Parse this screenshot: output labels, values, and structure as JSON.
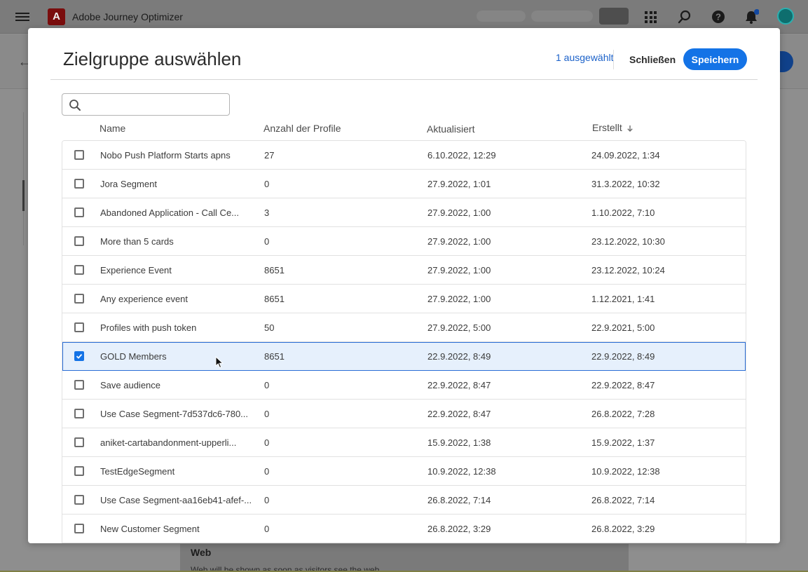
{
  "app": {
    "title": "Adobe Journey Optimizer",
    "logo_letter": "A"
  },
  "modal": {
    "title": "Zielgruppe auswählen",
    "selected_count": "1 ausgewählt",
    "close_label": "Schließen",
    "save_label": "Speichern",
    "search": {
      "value": "",
      "placeholder": ""
    }
  },
  "table": {
    "headers": {
      "name": "Name",
      "count": "Anzahl der Profile",
      "updated": "Aktualisiert",
      "created": "Erstellt"
    },
    "sort": {
      "column": "created",
      "direction": "descending"
    },
    "rows": [
      {
        "name": "Nobo Push Platform Starts apns",
        "count": "27",
        "updated": "6.10.2022, 12:29",
        "created": "24.09.2022, 1:34",
        "selected": false
      },
      {
        "name": "Jora Segment",
        "count": "0",
        "updated": "27.9.2022, 1:01",
        "created": "31.3.2022, 10:32",
        "selected": false
      },
      {
        "name": "Abandoned Application - Call Ce...",
        "count": "3",
        "updated": "27.9.2022, 1:00",
        "created": "1.10.2022, 7:10",
        "selected": false
      },
      {
        "name": "More than 5 cards",
        "count": "0",
        "updated": "27.9.2022, 1:00",
        "created": "23.12.2022, 10:30",
        "selected": false
      },
      {
        "name": "Experience Event",
        "count": "8651",
        "updated": "27.9.2022, 1:00",
        "created": "23.12.2022, 10:24",
        "selected": false
      },
      {
        "name": "Any experience event",
        "count": "8651",
        "updated": "27.9.2022, 1:00",
        "created": "1.12.2021, 1:41",
        "selected": false
      },
      {
        "name": "Profiles with push token",
        "count": "50",
        "updated": "27.9.2022, 5:00",
        "created": "22.9.2021, 5:00",
        "selected": false
      },
      {
        "name": "GOLD Members",
        "count": "8651",
        "updated": "22.9.2022, 8:49",
        "created": "22.9.2022, 8:49",
        "selected": true
      },
      {
        "name": "Save audience",
        "count": "0",
        "updated": "22.9.2022, 8:47",
        "created": "22.9.2022, 8:47",
        "selected": false
      },
      {
        "name": "Use Case Segment-7d537dc6-780...",
        "count": "0",
        "updated": "22.9.2022, 8:47",
        "created": "26.8.2022, 7:28",
        "selected": false
      },
      {
        "name": "aniket-cartabandonment-upperli...",
        "count": "0",
        "updated": "15.9.2022, 1:38",
        "created": "15.9.2022, 1:37",
        "selected": false
      },
      {
        "name": "TestEdgeSegment",
        "count": "0",
        "updated": "10.9.2022, 12:38",
        "created": "10.9.2022, 12:38",
        "selected": false
      },
      {
        "name": "Use Case Segment-aa16eb41-afef-...",
        "count": "0",
        "updated": "26.8.2022, 7:14",
        "created": "26.8.2022, 7:14",
        "selected": false
      },
      {
        "name": "New Customer Segment",
        "count": "0",
        "updated": "26.8.2022, 3:29",
        "created": "26.8.2022, 3:29",
        "selected": false
      }
    ]
  },
  "background": {
    "section_title": "Web",
    "section_subtitle": "Web will be shown as soon as visitors see the web"
  },
  "colors": {
    "accent": "#1473e6",
    "selected_row": "#e6f0fc",
    "link": "#1b61c9"
  }
}
